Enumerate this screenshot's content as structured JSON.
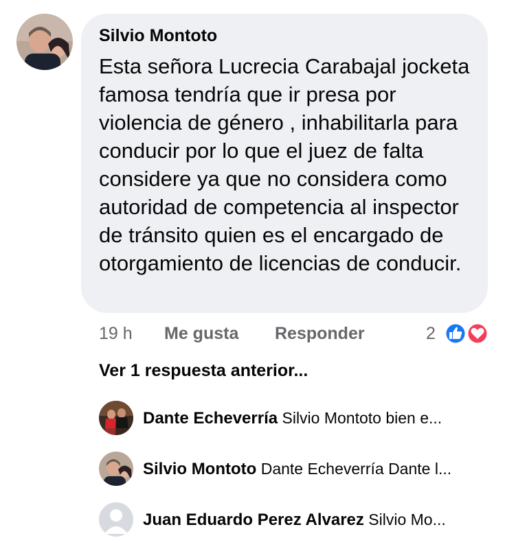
{
  "comment": {
    "author": "Silvio Montoto",
    "text": "Esta señora Lucrecia Carabajal jocketa famosa tendría que ir presa por violencia de género , inhabilitarla para conducir por lo que el juez de falta considere ya que no considera como autoridad de competencia al inspector de tránsito quien es el encargado de otorgamiento de licencias de conducir.",
    "time": "19 h",
    "like_label": "Me gusta",
    "reply_label": "Responder",
    "reaction_count": "2",
    "reaction_icons": [
      "like-icon",
      "love-icon"
    ]
  },
  "view_previous": "Ver 1 respuesta anterior...",
  "replies": [
    {
      "name": "Dante Echeverría",
      "preview": "Silvio Montoto bien e..."
    },
    {
      "name": "Silvio Montoto",
      "preview": "Dante Echeverría Dante l..."
    },
    {
      "name": "Juan Eduardo Perez Alvarez",
      "preview": "Silvio Mo..."
    }
  ],
  "colors": {
    "bubble": "#eff0f3",
    "secondary_text": "#65676b",
    "like_blue": "#1877f2",
    "love_red": "#f33e58"
  }
}
